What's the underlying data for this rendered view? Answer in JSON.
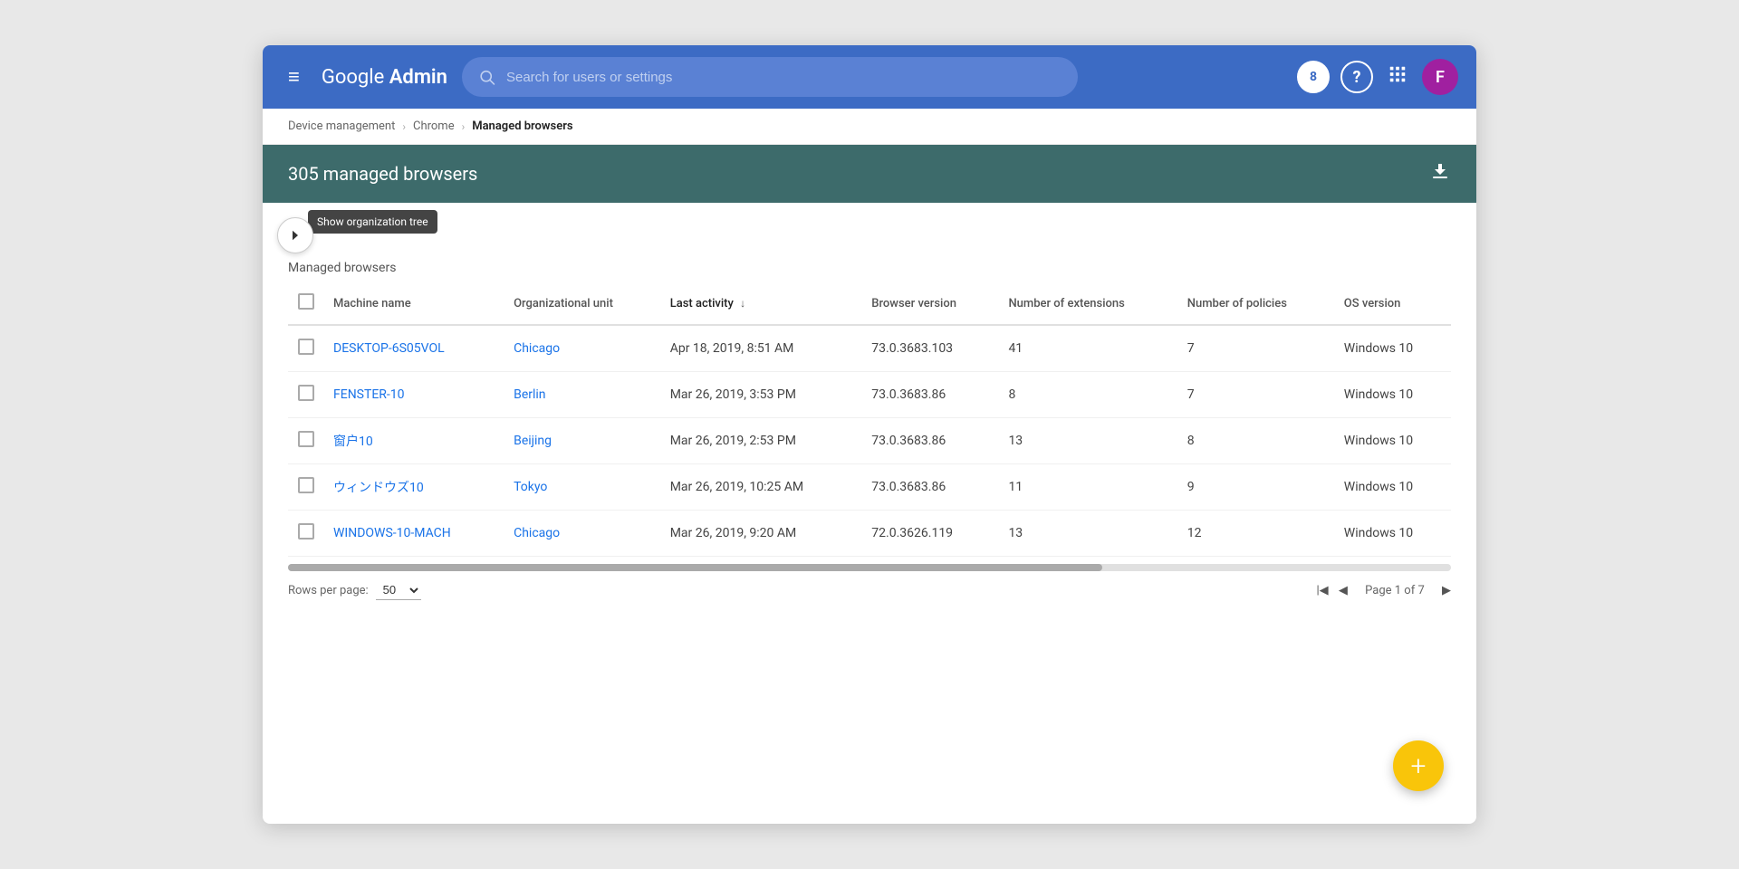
{
  "topbar": {
    "logo": "Google Admin",
    "search_placeholder": "Search for users or settings",
    "badge_count": "8",
    "avatar_letter": "F",
    "menu_icon": "≡",
    "grid_icon": "⋮⋮⋮",
    "help_icon": "?",
    "download_icon": "⬇"
  },
  "breadcrumb": {
    "items": [
      {
        "label": "Device management",
        "link": true
      },
      {
        "label": "Chrome",
        "link": true
      },
      {
        "label": "Managed browsers",
        "link": false
      }
    ]
  },
  "page_header": {
    "title": "305 managed browsers"
  },
  "org_tree": {
    "tooltip": "Show organization tree",
    "button_icon": "›"
  },
  "sub_header": {
    "text": "Managed browsers"
  },
  "table": {
    "columns": [
      {
        "key": "checkbox",
        "label": ""
      },
      {
        "key": "machine_name",
        "label": "Machine name"
      },
      {
        "key": "org_unit",
        "label": "Organizational unit"
      },
      {
        "key": "last_activity",
        "label": "Last activity",
        "sorted": true,
        "sort_dir": "↓"
      },
      {
        "key": "browser_version",
        "label": "Browser version"
      },
      {
        "key": "num_extensions",
        "label": "Number of extensions"
      },
      {
        "key": "num_policies",
        "label": "Number of policies"
      },
      {
        "key": "os_version",
        "label": "OS version"
      }
    ],
    "rows": [
      {
        "machine_name": "DESKTOP-6S05VOL",
        "org_unit": "Chicago",
        "last_activity": "Apr 18, 2019, 8:51 AM",
        "browser_version": "73.0.3683.103",
        "num_extensions": "41",
        "num_policies": "7",
        "os_version": "Windows 10"
      },
      {
        "machine_name": "FENSTER-10",
        "org_unit": "Berlin",
        "last_activity": "Mar 26, 2019, 3:53 PM",
        "browser_version": "73.0.3683.86",
        "num_extensions": "8",
        "num_policies": "7",
        "os_version": "Windows 10"
      },
      {
        "machine_name": "窗户10",
        "org_unit": "Beijing",
        "last_activity": "Mar 26, 2019, 2:53 PM",
        "browser_version": "73.0.3683.86",
        "num_extensions": "13",
        "num_policies": "8",
        "os_version": "Windows 10"
      },
      {
        "machine_name": "ウィンドウズ10",
        "org_unit": "Tokyo",
        "last_activity": "Mar 26, 2019, 10:25 AM",
        "browser_version": "73.0.3683.86",
        "num_extensions": "11",
        "num_policies": "9",
        "os_version": "Windows 10"
      },
      {
        "machine_name": "WINDOWS-10-MACH",
        "org_unit": "Chicago",
        "last_activity": "Mar 26, 2019, 9:20 AM",
        "browser_version": "72.0.3626.119",
        "num_extensions": "13",
        "num_policies": "12",
        "os_version": "Windows 10"
      }
    ]
  },
  "footer": {
    "rows_per_page_label": "Rows per page:",
    "rows_per_page_value": "50",
    "page_label": "Page 1 of 7"
  },
  "fab": {
    "icon": "+"
  }
}
